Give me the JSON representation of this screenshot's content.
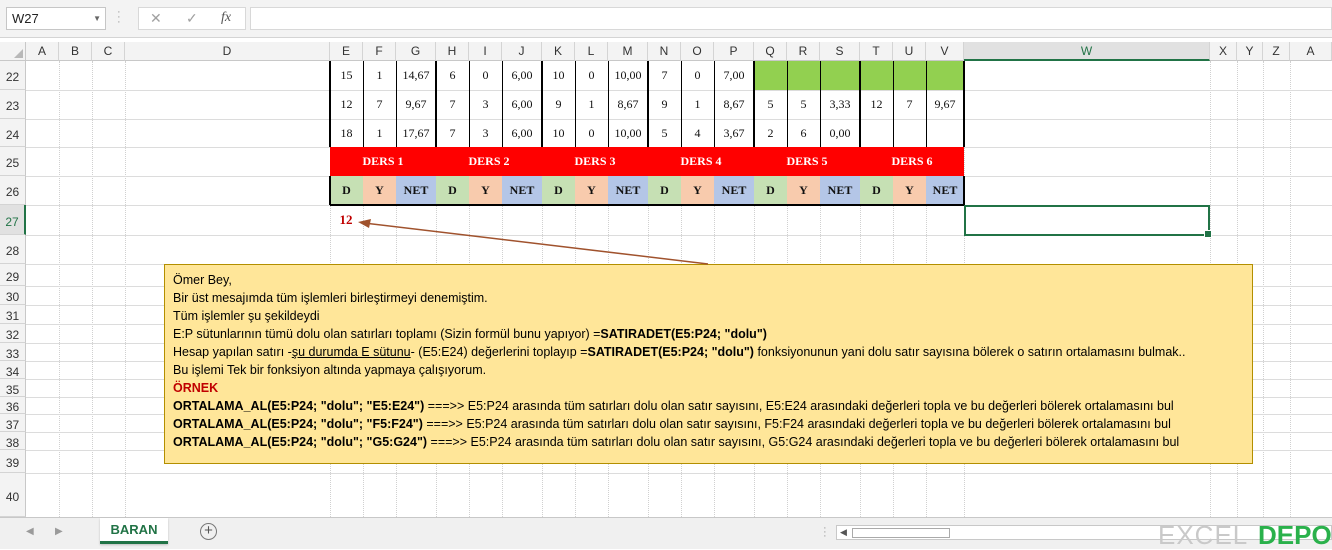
{
  "formula_bar": {
    "name_box": "W27",
    "cancel_symbol": "✕",
    "enter_symbol": "✓",
    "function_symbol": "fx",
    "formula": ""
  },
  "columns": [
    "A",
    "B",
    "C",
    "D",
    "E",
    "F",
    "G",
    "H",
    "I",
    "J",
    "K",
    "L",
    "M",
    "N",
    "O",
    "P",
    "Q",
    "R",
    "S",
    "T",
    "U",
    "V",
    "W",
    "X",
    "Y",
    "Z",
    "A"
  ],
  "rows": [
    "22",
    "23",
    "24",
    "25",
    "26",
    "27",
    "28",
    "29",
    "30",
    "31",
    "32",
    "33",
    "34",
    "35",
    "36",
    "37",
    "38",
    "39",
    "40"
  ],
  "table": {
    "row22": [
      "15",
      "1",
      "14,67",
      "6",
      "0",
      "6,00",
      "10",
      "0",
      "10,00",
      "7",
      "0",
      "7,00",
      "",
      "",
      "",
      "",
      "",
      ""
    ],
    "row23": [
      "12",
      "7",
      "9,67",
      "7",
      "3",
      "6,00",
      "9",
      "1",
      "8,67",
      "9",
      "1",
      "8,67",
      "5",
      "5",
      "3,33",
      "12",
      "7",
      "9,67"
    ],
    "row24": [
      "18",
      "1",
      "17,67",
      "7",
      "3",
      "6,00",
      "10",
      "0",
      "10,00",
      "5",
      "4",
      "3,67",
      "2",
      "6",
      "0,00",
      "",
      "",
      ""
    ],
    "ders_headers": [
      "DERS 1",
      "DERS 2",
      "DERS 3",
      "DERS 4",
      "DERS 5",
      "DERS 6"
    ],
    "sub_headers": [
      "D",
      "Y",
      "NET"
    ],
    "e27_value": "12"
  },
  "comment": {
    "line1": "Ömer Bey,",
    "line2": "Bir üst mesajımda tüm işlemleri birleştirmeyi denemiştim.",
    "line3": "Tüm işlemler şu şekildeydi",
    "line4_text": "E:P sütunlarının tümü dolu olan satırları toplamı (Sizin formül bunu yapıyor) =",
    "line4_bold": "SATIRADET(E5:P24; \"dolu\")",
    "line5_a": "Hesap yapılan satırı -",
    "line5_u": "şu durumda E sütunu",
    "line5_b": "- (E5:E24) değerlerini toplayıp =",
    "line5_bold": "SATIRADET(E5:P24; \"dolu\")",
    "line5_c": " fonksiyonunun yani dolu satır sayısına bölerek o satırın ortalamasını bulmak..",
    "line6": "Bu işlemi Tek bir fonksiyon altında yapmaya çalışıyorum.",
    "line7": "ÖRNEK",
    "ex1_bold": "ORTALAMA_AL(E5:P24; \"dolu\"; \"E5:E24\")",
    "ex1_text": "  ===>> E5:P24 arasında tüm satırları dolu olan satır sayısını, E5:E24 arasındaki değerleri topla ve bu değerleri bölerek ortalamasını bul",
    "ex2_bold": "ORTALAMA_AL(E5:P24; \"dolu\"; \"F5:F24\")",
    "ex2_text": "  ===>> E5:P24 arasında tüm satırları dolu olan satır sayısını, F5:F24 arasındaki değerleri topla ve bu değerleri bölerek ortalamasını bul",
    "ex3_bold": "ORTALAMA_AL(E5:P24; \"dolu\"; \"G5:G24\")",
    "ex3_text": "  ===>> E5:P24 arasında tüm satırları dolu olan satır sayısını, G5:G24 arasındaki değerleri topla ve bu değerleri bölerek ortalamasını bul"
  },
  "sheet_tabs": {
    "active": "BARAN",
    "add_symbol": "+"
  },
  "watermark": {
    "excel": "EXCEL",
    "depo": "DEPO"
  },
  "colors": {
    "excel_green": "#217346",
    "ders_red": "#ff0000",
    "d_green": "#c6e0b4",
    "y_peach": "#f8cbad",
    "net_blue": "#b4c6e7",
    "note_yellow": "#ffe699",
    "fill_green": "#92d050"
  }
}
